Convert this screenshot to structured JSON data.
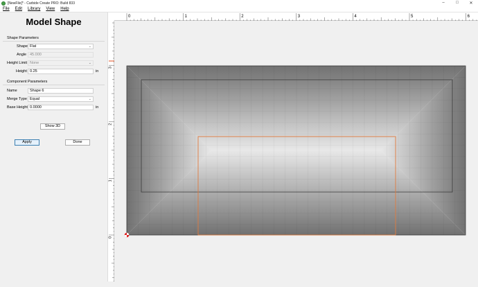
{
  "window": {
    "title": "[NewFile]* - Carbide Create PRO: Build 833",
    "minimize_glyph": "–",
    "maximize_glyph": "□",
    "close_glyph": "✕"
  },
  "menu": {
    "items": [
      {
        "label": "File"
      },
      {
        "label": "Edit"
      },
      {
        "label": "Library"
      },
      {
        "label": "View"
      },
      {
        "label": "Help"
      }
    ]
  },
  "panel": {
    "title": "Model Shape",
    "shape_params": {
      "header": "Shape Parameters",
      "shape_label": "Shape",
      "shape_value": "Flat",
      "angle_label": "Angle",
      "angle_value": "45.000",
      "height_limit_label": "Height Limit",
      "height_limit_value": "None",
      "height_label": "Height",
      "height_value": "0.25",
      "height_unit": "in"
    },
    "component_params": {
      "header": "Component Parameters",
      "name_label": "Name",
      "name_value": "Shape 6",
      "merge_type_label": "Merge Type",
      "merge_type_value": "Equal",
      "base_height_label": "Base Height",
      "base_height_value": "0.0000",
      "base_height_unit": "in"
    },
    "show3d_label": "Show 3D",
    "apply_label": "Apply",
    "done_label": "Done"
  },
  "rulers": {
    "horizontal_labels": [
      "0",
      "1",
      "2",
      "3",
      "4",
      "5",
      "6"
    ],
    "vertical_labels": [
      "0",
      "1",
      "2",
      "3"
    ]
  },
  "colors": {
    "selection": "#e07a3e",
    "origin_marker": "#e02020",
    "ruler_marker": "#e05020"
  }
}
